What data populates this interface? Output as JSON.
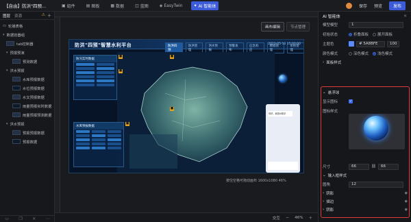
{
  "topbar": {
    "project_title": "【自由】防洪\"四预...",
    "tabs": [
      {
        "label": "组件",
        "icon": "component-icon"
      },
      {
        "label": "图板",
        "icon": "board-icon"
      },
      {
        "label": "数据",
        "icon": "data-icon"
      },
      {
        "label": "蓝图",
        "icon": "blueprint-icon"
      },
      {
        "label": "EasyTwin",
        "icon": "twin-icon"
      },
      {
        "label": "AI 智能体",
        "icon": "ai-icon"
      }
    ],
    "save": "保存",
    "preview": "预览",
    "publish": "发布"
  },
  "leftpanel": {
    "tabs": [
      "图层",
      "资源"
    ],
    "warn": "⚠",
    "tree": [
      {
        "level": "l1",
        "label": "轮播表格",
        "thumb": false
      },
      {
        "level": "l1",
        "label": "数据容器组",
        "thumb": false,
        "chev": "▾"
      },
      {
        "level": "l2",
        "label": "tab控制器",
        "thumb": true
      },
      {
        "level": "l2",
        "label": "预报预演",
        "thumb": false,
        "chev": "▾"
      },
      {
        "level": "l3",
        "label": "预测数据",
        "thumb": true
      },
      {
        "level": "l2",
        "label": "洪水预报",
        "thumb": false,
        "chev": "▾"
      },
      {
        "level": "l3",
        "label": "水库预报数据",
        "thumb": true
      },
      {
        "level": "l3",
        "label": "水位预报数据",
        "thumb": true
      },
      {
        "level": "l3",
        "label": "水文预报数据",
        "thumb": true
      },
      {
        "level": "l3",
        "label": "雨量预报实时数据",
        "thumb": true
      },
      {
        "level": "l3",
        "label": "雨量预报预测数据",
        "thumb": true
      },
      {
        "level": "l2",
        "label": "洪水预报",
        "thumb": false,
        "chev": "▾"
      },
      {
        "level": "l3",
        "label": "预报预报数据",
        "thumb": true
      },
      {
        "level": "l3",
        "label": "预报数据",
        "thumb": true
      }
    ]
  },
  "canvas": {
    "btn_edit": "画布编辑",
    "btn_node": "节点管理",
    "status": "按住空格可拖动画布  1600x1080 46%",
    "bottom_items": [
      "交互",
      "46%"
    ]
  },
  "dashboard": {
    "title": "防洪\"四预\"智慧水利平台",
    "nav": [
      "防洪四预",
      "防洪管理",
      "洪水预报",
      "预警发布",
      "应急响应",
      "数据管理",
      "系统管理"
    ],
    "time": "2023-05-10 15:00:00",
    "panel1_title": "防汛实时数据",
    "panel2_title": "水库预报数据",
    "chat_msg": "你好，我是AI助手"
  },
  "rightpanel": {
    "title": "AI 智能体",
    "props": {
      "layer_label": "模型模型",
      "layer_value": "1",
      "initial_label": "初始状态",
      "initial_opts": [
        "折叠面板",
        "展开面板"
      ],
      "theme_label": "主题色",
      "theme_value": "# 5A8BFE",
      "theme_opacity": "100",
      "mode_label": "颜色模式",
      "mode_opts": [
        "深色模式",
        "浅色模式"
      ],
      "panel_style": "面板样式"
    },
    "bubble": {
      "section": "悬浮球",
      "show_label": "显示图标",
      "icon_style_label": "图标样式",
      "size_label": "尺寸",
      "size_w": "66",
      "size_h": "66",
      "input_section": "输入框样式",
      "radius_label": "圆角",
      "radius_value": "12",
      "shadow": "阴影",
      "stroke": "描边",
      "shadow2": "阴影"
    }
  },
  "colors": {
    "accent": "#3b5bd9",
    "theme": "#5A8BFE",
    "highlight": "#e03a3a"
  }
}
